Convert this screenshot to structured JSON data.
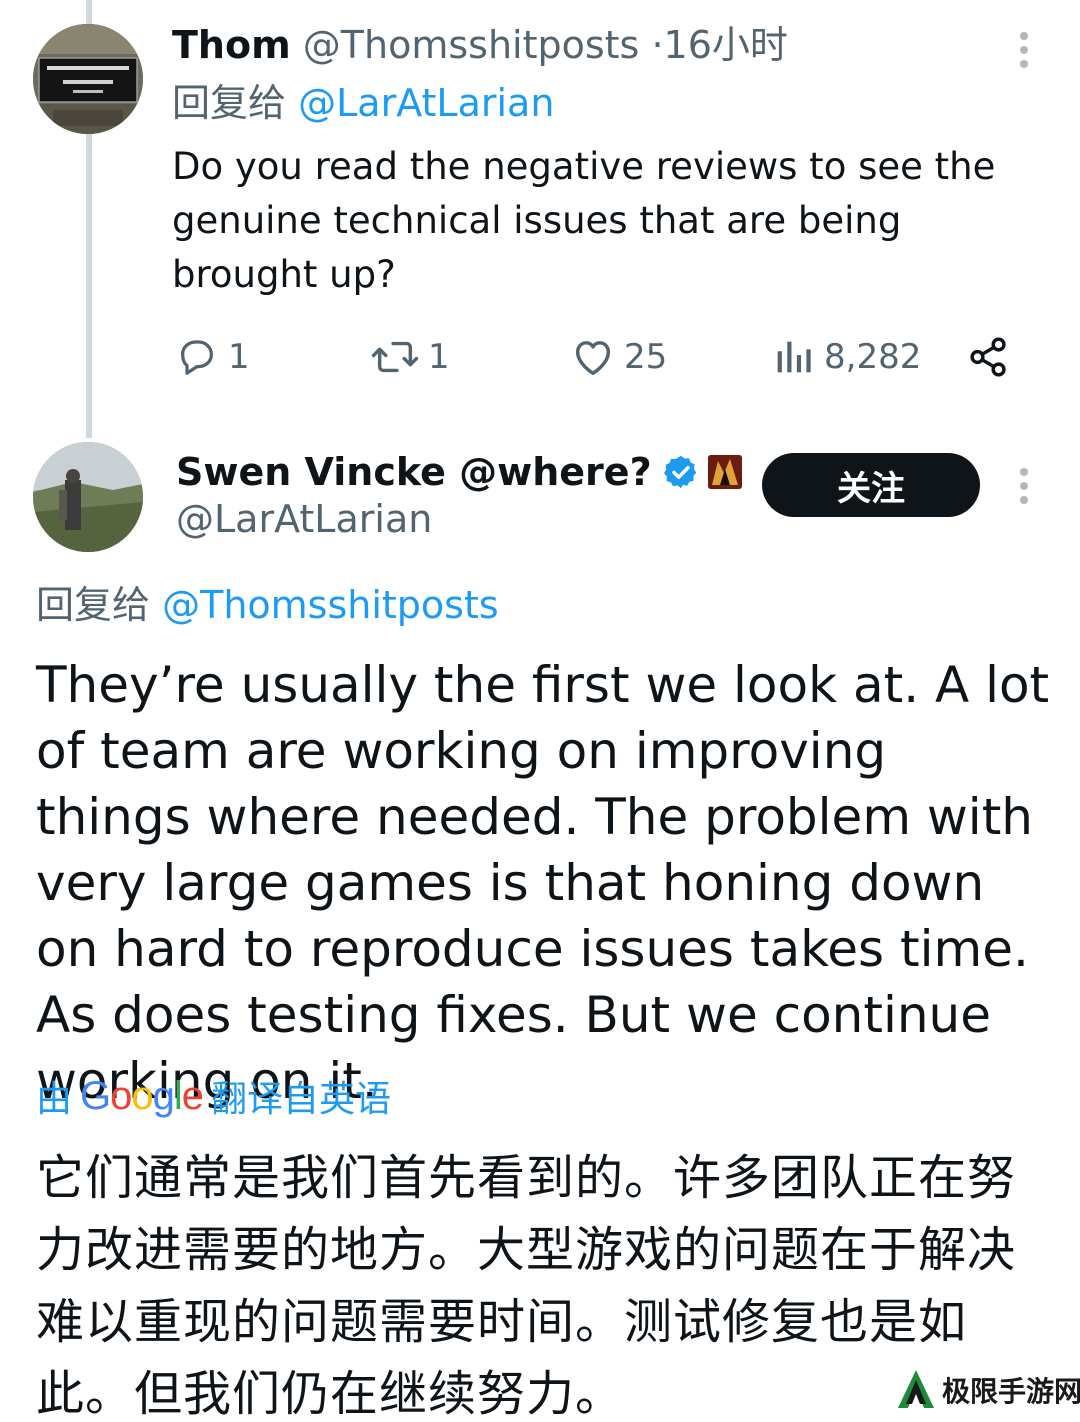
{
  "tweet1": {
    "name": "Thom",
    "handle": "@Thomsshitposts",
    "dot": "·",
    "time": "16小时",
    "reply_prefix": "回复给",
    "reply_to": "@LarAtLarian",
    "text": "Do you read the negative reviews to see the genuine technical issues that are being brought up?",
    "actions": {
      "replies": "1",
      "retweets": "1",
      "likes": "25",
      "views": "8,282"
    }
  },
  "tweet2": {
    "name": "Swen Vincke @where?",
    "handle": "@LarAtLarian",
    "follow_label": "关注",
    "reply_prefix": "回复给",
    "reply_to": "@Thomsshitposts",
    "text": "They’re usually the first we look at. A lot of team are working on improving things where needed. The problem with very large games is that honing down on hard to reproduce issues takes time. As does testing fixes. But we continue working on it.",
    "translated_prefix": "由",
    "translated_brand": "Google",
    "translated_suffix": "翻译自英语",
    "translation": "它们通常是我们首先看到的。许多团队正在努力改进需要的地方。大型游戏的问题在于解决难以重现的问题需要时间。测试修复也是如此。但我们仍在继续努力。"
  },
  "watermark": {
    "text": "极限手游网"
  },
  "colors": {
    "link": "#1d9bf0",
    "muted": "#536471",
    "text": "#0f1419",
    "follow_bg": "#0f1419"
  },
  "icons": [
    "reply-icon",
    "retweet-icon",
    "like-icon",
    "views-icon",
    "share-icon",
    "more-icon",
    "verified-icon"
  ]
}
